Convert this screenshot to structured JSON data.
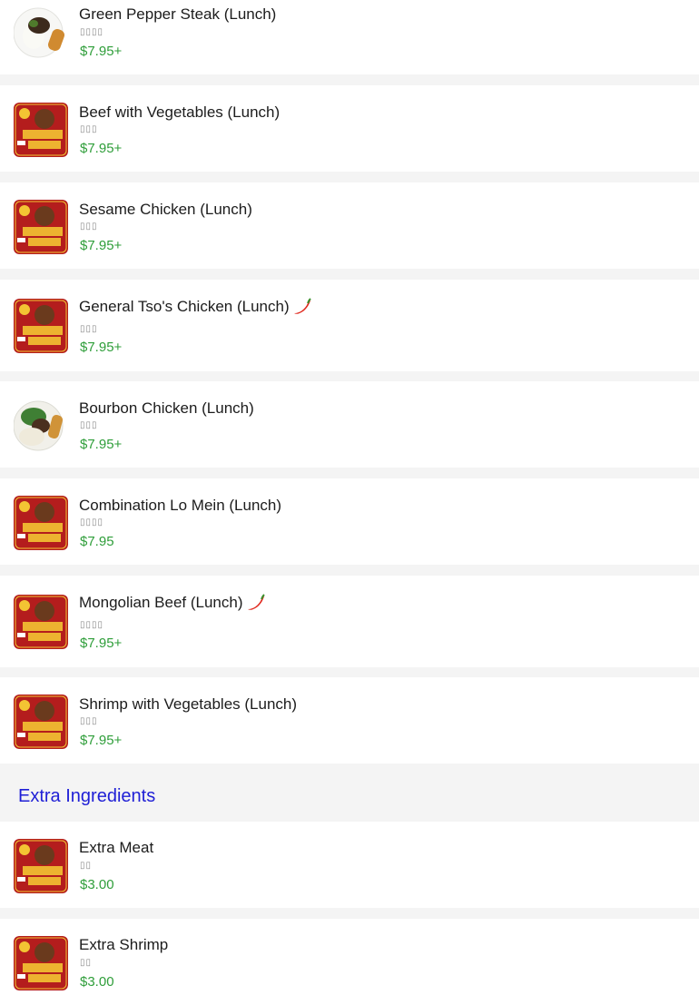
{
  "items": [
    {
      "name": "Green Pepper Steak (Lunch)",
      "sub": "▯▯▯▯",
      "price": "$7.95+",
      "image": "food-photo",
      "spicy": false
    },
    {
      "name": "Beef with Vegetables (Lunch)",
      "sub": "▯▯▯",
      "price": "$7.95+",
      "image": "golden-wok-logo",
      "spicy": false
    },
    {
      "name": "Sesame Chicken (Lunch)",
      "sub": "▯▯▯",
      "price": "$7.95+",
      "image": "golden-wok-logo",
      "spicy": false
    },
    {
      "name": "General Tso's Chicken (Lunch)",
      "sub": "▯▯▯",
      "price": "$7.95+",
      "image": "golden-wok-logo",
      "spicy": true
    },
    {
      "name": "Bourbon Chicken (Lunch)",
      "sub": "▯▯▯",
      "price": "$7.95+",
      "image": "food-photo",
      "spicy": false
    },
    {
      "name": "Combination Lo Mein (Lunch)",
      "sub": "▯▯▯▯",
      "price": "$7.95",
      "image": "golden-wok-logo",
      "spicy": false
    },
    {
      "name": "Mongolian Beef (Lunch)",
      "sub": "▯▯▯▯",
      "price": "$7.95+",
      "image": "golden-wok-logo",
      "spicy": true
    },
    {
      "name": "Shrimp with Vegetables (Lunch)",
      "sub": "▯▯▯",
      "price": "$7.95+",
      "image": "golden-wok-logo",
      "spicy": false
    },
    {
      "name": "Extra Meat",
      "sub": "▯▯",
      "price": "$3.00",
      "image": "golden-wok-logo",
      "spicy": false
    },
    {
      "name": "Extra Shrimp",
      "sub": "▯▯",
      "price": "$3.00",
      "image": "golden-wok-logo",
      "spicy": false
    }
  ],
  "section": {
    "title": "Extra Ingredients"
  },
  "colors": {
    "price": "#2f9e3a",
    "section_title": "#1f1fd6",
    "logo_red": "#b41d1d",
    "logo_gold": "#f3c433"
  },
  "icons": {
    "spicy": "chili-pepper-icon"
  }
}
